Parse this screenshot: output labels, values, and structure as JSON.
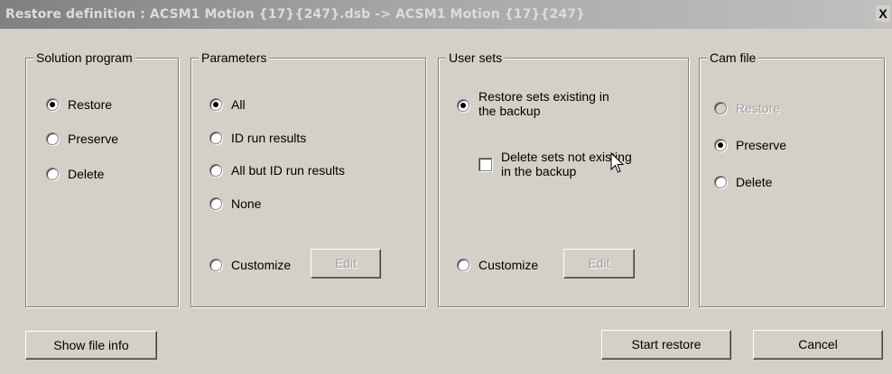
{
  "window": {
    "title": "Restore definition : ACSM1 Motion {17}{247}.dsb -> ACSM1 Motion {17}{247}",
    "close_label": "X"
  },
  "solution_program": {
    "title": "Solution program",
    "options": [
      {
        "label": "Restore",
        "selected": true
      },
      {
        "label": "Preserve",
        "selected": false
      },
      {
        "label": "Delete",
        "selected": false
      }
    ]
  },
  "parameters": {
    "title": "Parameters",
    "options": [
      {
        "label": "All",
        "selected": true
      },
      {
        "label": "ID run results",
        "selected": false
      },
      {
        "label": "All but ID run results",
        "selected": false
      },
      {
        "label": "None",
        "selected": false
      },
      {
        "label": "Customize",
        "selected": false
      }
    ],
    "edit_label": "Edit"
  },
  "user_sets": {
    "title": "User sets",
    "restore_line1": "Restore sets existing in",
    "restore_line2": "the backup",
    "delete_line1": "Delete sets not existing",
    "delete_line2": "in the backup",
    "delete_checked": false,
    "customize_label": "Customize",
    "edit_label": "Edit"
  },
  "cam_file": {
    "title": "Cam file",
    "options": [
      {
        "label": "Restore",
        "selected": false,
        "disabled": true
      },
      {
        "label": "Preserve",
        "selected": true,
        "disabled": false
      },
      {
        "label": "Delete",
        "selected": false,
        "disabled": false
      }
    ]
  },
  "footer": {
    "show_file_info": "Show file info",
    "start_restore": "Start restore",
    "cancel": "Cancel"
  }
}
